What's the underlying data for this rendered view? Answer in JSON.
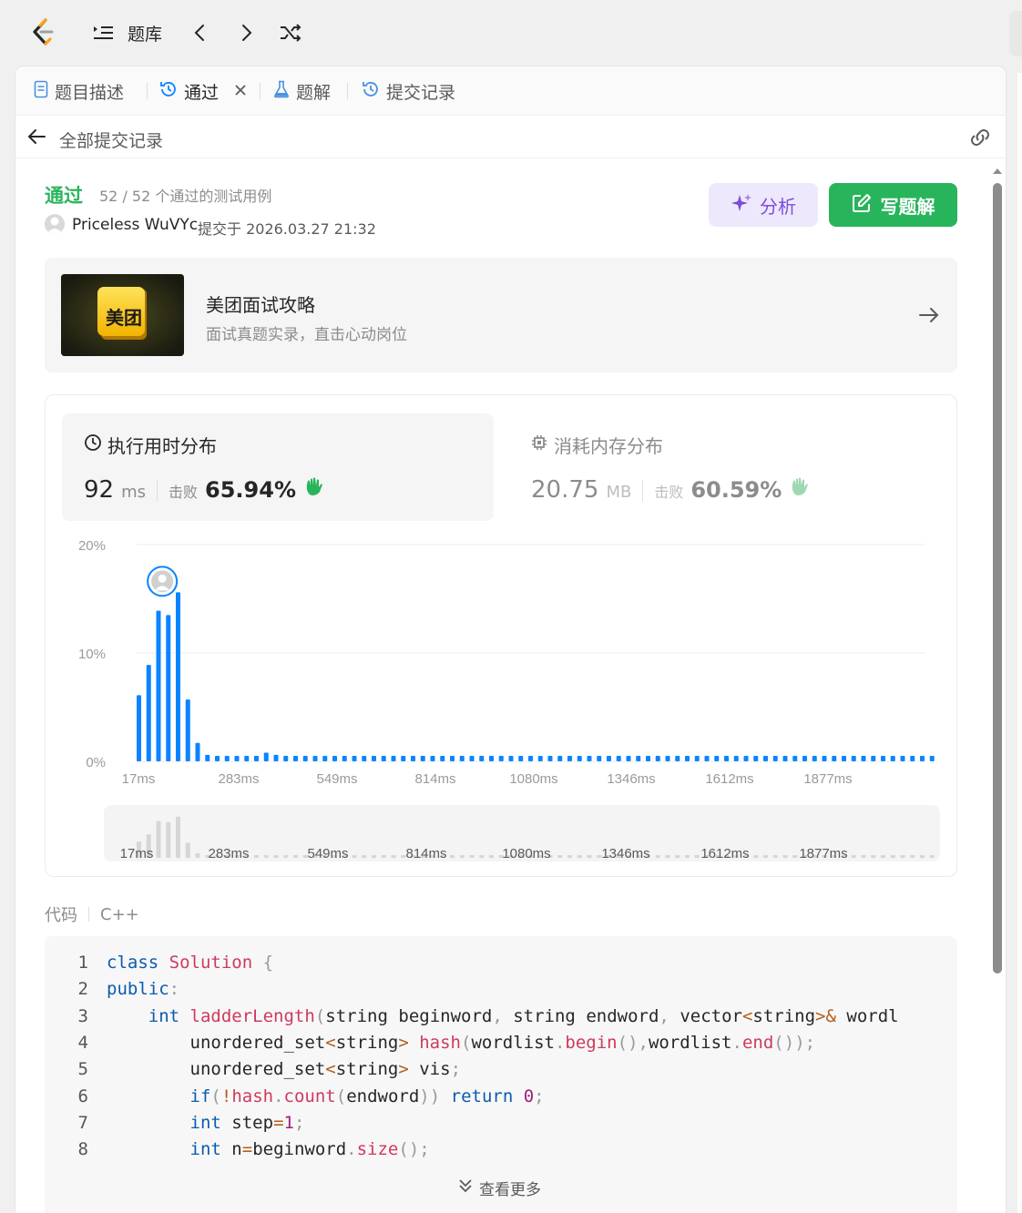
{
  "topbar": {
    "problem_bank_label": "题库"
  },
  "tabs": [
    {
      "label": "题目描述",
      "active": false
    },
    {
      "label": "通过",
      "active": true
    },
    {
      "label": "题解",
      "active": false
    },
    {
      "label": "提交记录",
      "active": false
    }
  ],
  "subheader": {
    "back_label": "全部提交记录"
  },
  "result": {
    "status": "通过",
    "cases": "52 / 52 个通过的测试用例",
    "user": "Priceless WuVYc",
    "submitted_at": "提交于 2026.03.27 21:32"
  },
  "buttons": {
    "analyze": "分析",
    "write_solution": "写题解"
  },
  "promo": {
    "badge": "美团",
    "title": "美团面试攻略",
    "subtitle": "面试真题实录，直击心动岗位"
  },
  "runtime": {
    "title": "执行用时分布",
    "value": "92",
    "unit": "ms",
    "beat_label": "击败",
    "beat_pct": "65.94%"
  },
  "memory": {
    "title": "消耗内存分布",
    "value": "20.75",
    "unit": "MB",
    "beat_label": "击败",
    "beat_pct": "60.59%"
  },
  "chart_data": {
    "type": "bar",
    "ylabel": "",
    "xlabel": "",
    "y_ticks": [
      "0%",
      "10%",
      "20%"
    ],
    "ylim": [
      0,
      20
    ],
    "x_ticks": [
      "17ms",
      "283ms",
      "549ms",
      "814ms",
      "1080ms",
      "1346ms",
      "1612ms",
      "1877ms"
    ],
    "values": [
      6.1,
      8.9,
      13.9,
      13.5,
      15.6,
      5.7,
      1.7,
      0.6,
      0.5,
      0.5,
      0.5,
      0.5,
      0.5,
      0.8,
      0.6,
      0.5,
      0.5,
      0.5,
      0.5,
      0.5,
      0.5,
      0.5,
      0.5,
      0.5,
      0.5,
      0.5,
      0.5,
      0.5,
      0.5,
      0.5,
      0.5,
      0.5,
      0.5,
      0.5,
      0.5,
      0.5,
      0.5,
      0.5,
      0.5,
      0.5,
      0.5,
      0.5,
      0.5,
      0.5,
      0.5,
      0.5,
      0.5,
      0.5,
      0.5,
      0.5,
      0.5,
      0.5,
      0.5,
      0.5,
      0.5,
      0.5,
      0.5,
      0.5,
      0.5,
      0.5,
      0.5,
      0.5,
      0.5,
      0.5,
      0.5,
      0.5,
      0.5,
      0.5,
      0.5,
      0.5,
      0.5,
      0.5,
      0.5,
      0.5,
      0.5,
      0.5,
      0.5,
      0.5,
      0.5,
      0.5,
      0.5,
      0.5
    ],
    "highlight_index": 2,
    "grid": true,
    "bar_color": "#0a84ff"
  },
  "code": {
    "label": "代码",
    "lang": "C++",
    "more_label": "查看更多",
    "lines": [
      "class Solution {",
      "public:",
      "    int ladderLength(string beginword, string endword, vector<string>& wordl",
      "        unordered_set<string> hash(wordlist.begin(),wordlist.end());",
      "        unordered_set<string> vis;",
      "        if(!hash.count(endword)) return 0;",
      "        int step=1;",
      "        int n=beginword.size();"
    ]
  },
  "colors": {
    "accept": "#2db55d",
    "accent_blue": "#0a84ff",
    "purple": "#7c4ddb",
    "green_button": "#28b45b"
  }
}
